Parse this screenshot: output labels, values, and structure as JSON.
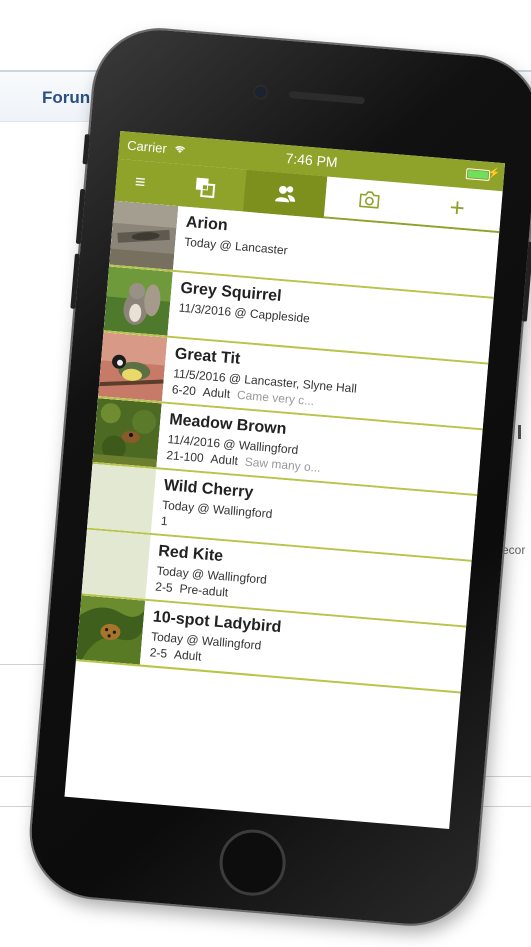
{
  "background": {
    "forum_label": "Forun",
    "side_text": "recor"
  },
  "status_bar": {
    "carrier": "Carrier",
    "time": "7:46 PM"
  },
  "tab_bar": {
    "icons": [
      "menu-icon",
      "records-icon",
      "users-icon",
      "camera-icon",
      "plus-icon"
    ],
    "menu_glyph": "≡",
    "plus_glyph": "+"
  },
  "records": [
    {
      "name": "Arion",
      "meta": "Today @ Lancaster",
      "count": "",
      "stage": "",
      "note": "",
      "thumb": "slug-photo"
    },
    {
      "name": "Grey Squirrel",
      "meta": "11/3/2016 @ Cappleside",
      "count": "",
      "stage": "",
      "note": "",
      "thumb": "squirrel-photo"
    },
    {
      "name": "Great Tit",
      "meta": "11/5/2016 @ Lancaster, Slyne Hall",
      "count": "6-20",
      "stage": "Adult",
      "note": "Came very c...",
      "thumb": "bird-photo"
    },
    {
      "name": "Meadow Brown",
      "meta": "11/4/2016 @ Wallingford",
      "count": "21-100",
      "stage": "Adult",
      "note": "Saw many o...",
      "thumb": "butterfly-photo"
    },
    {
      "name": "Wild Cherry",
      "meta": "Today @ Wallingford",
      "count": "1",
      "stage": "",
      "note": "",
      "thumb": "blank"
    },
    {
      "name": "Red Kite",
      "meta": "Today @ Wallingford",
      "count": "2-5",
      "stage": "Pre-adult",
      "note": "",
      "thumb": "blank"
    },
    {
      "name": "10-spot Ladybird",
      "meta": "Today @ Wallingford",
      "count": "2-5",
      "stage": "Adult",
      "note": "",
      "thumb": "ladybird-photo"
    }
  ],
  "colors": {
    "accent": "#8fa22a",
    "accent_dark": "#7d8f1c",
    "row_divider": "#b8c54a"
  }
}
